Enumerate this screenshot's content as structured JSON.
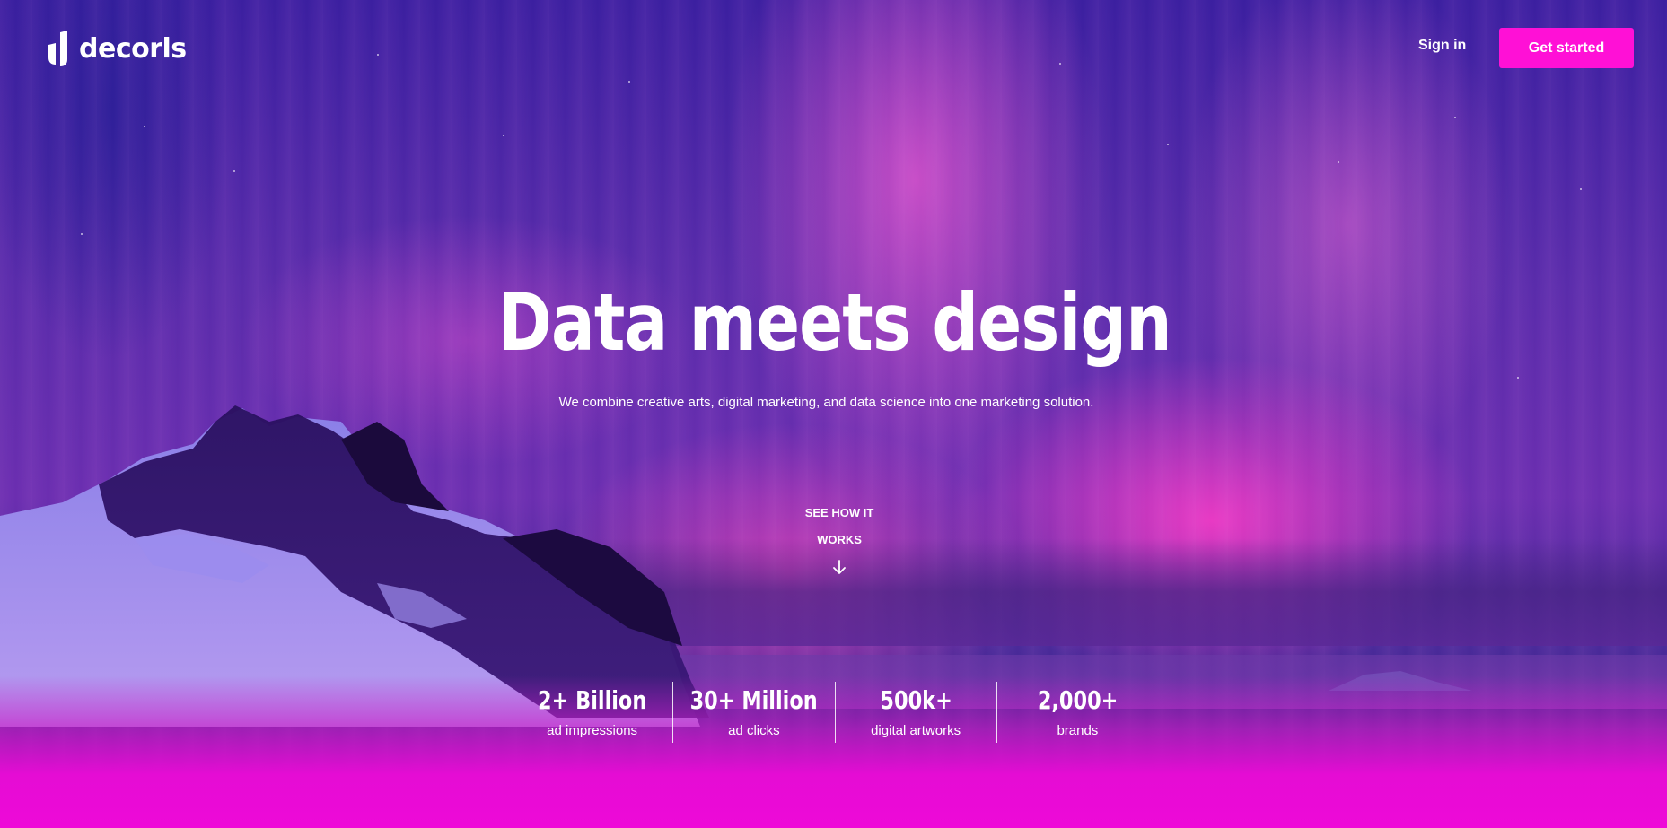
{
  "brand": {
    "name": "decorls"
  },
  "nav": {
    "signin_label": "Sign in",
    "cta_label": "Get started",
    "cta_color": "#ff10d6"
  },
  "hero": {
    "headline": "Data meets design",
    "subline": "We combine creative arts, digital marketing, and data science into one marketing solution.",
    "see_how_line1": "SEE HOW IT",
    "see_how_line2": "WORKS",
    "arrow_icon": "arrow-down-icon"
  },
  "stats": [
    {
      "value": "2+ Billion",
      "label": "ad impressions"
    },
    {
      "value": "30+ Million",
      "label": "ad clicks"
    },
    {
      "value": "500k+",
      "label": "digital artworks"
    },
    {
      "value": "2,000+",
      "label": "brands"
    }
  ]
}
